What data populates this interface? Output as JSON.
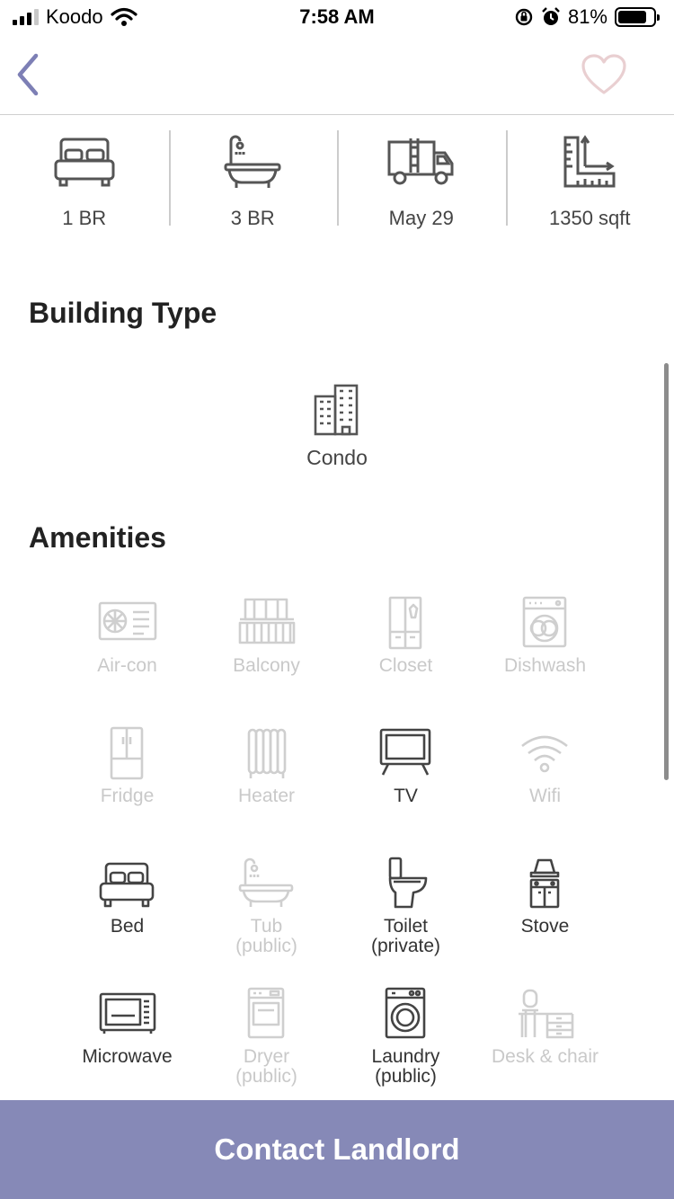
{
  "status_bar": {
    "carrier": "Koodo",
    "time": "7:58 AM",
    "battery": "81%",
    "battery_level": 0.81
  },
  "nav": {
    "back_icon": "chevron-left-icon",
    "favorite_icon": "heart-outline-icon",
    "accent_color": "#7d7fb5",
    "heart_color": "#e9cfd1"
  },
  "stats": [
    {
      "icon": "bed-icon",
      "label": "1 BR"
    },
    {
      "icon": "bathtub-icon",
      "label": "3 BR"
    },
    {
      "icon": "moving-truck-icon",
      "label": "May 29"
    },
    {
      "icon": "area-ruler-icon",
      "label": "1350 sqft"
    }
  ],
  "building_section": {
    "title": "Building Type",
    "type": {
      "icon": "condo-building-icon",
      "label": "Condo"
    }
  },
  "amenities_section": {
    "title": "Amenities",
    "items": [
      {
        "icon": "aircon-icon",
        "label": "Air-con",
        "available": false
      },
      {
        "icon": "balcony-icon",
        "label": "Balcony",
        "available": false
      },
      {
        "icon": "closet-icon",
        "label": "Closet",
        "available": false
      },
      {
        "icon": "dishwasher-icon",
        "label": "Dishwash",
        "available": false
      },
      {
        "icon": "fridge-icon",
        "label": "Fridge",
        "available": false
      },
      {
        "icon": "heater-icon",
        "label": "Heater",
        "available": false
      },
      {
        "icon": "tv-icon",
        "label": "TV",
        "available": true
      },
      {
        "icon": "wifi-icon",
        "label": "Wifi",
        "available": false
      },
      {
        "icon": "bed-icon",
        "label": "Bed",
        "available": true
      },
      {
        "icon": "bathtub-icon",
        "label": "Tub\n(public)",
        "available": false
      },
      {
        "icon": "toilet-icon",
        "label": "Toilet\n(private)",
        "available": true
      },
      {
        "icon": "stove-icon",
        "label": "Stove",
        "available": true
      },
      {
        "icon": "microwave-icon",
        "label": "Microwave",
        "available": true
      },
      {
        "icon": "dryer-icon",
        "label": "Dryer\n(public)",
        "available": false
      },
      {
        "icon": "laundry-icon",
        "label": "Laundry\n(public)",
        "available": true
      },
      {
        "icon": "desk-chair-icon",
        "label": "Desk & chair",
        "available": false
      }
    ]
  },
  "cta": {
    "label": "Contact Landlord",
    "color": "#8689b7"
  }
}
